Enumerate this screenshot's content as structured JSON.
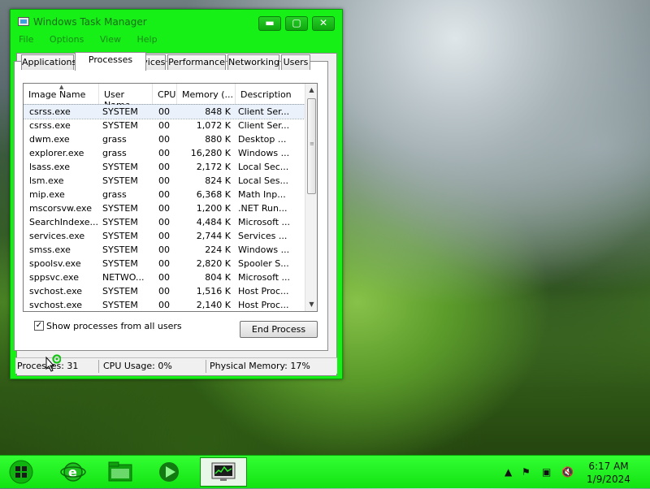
{
  "window": {
    "title": "Windows Task Manager",
    "buttons": {
      "minimize": "▬",
      "maximize": "▢",
      "close": "✕"
    }
  },
  "menu": [
    "File",
    "Options",
    "View",
    "Help"
  ],
  "tabs": [
    "Applications",
    "Processes",
    "Services",
    "Performance",
    "Networking",
    "Users"
  ],
  "active_tab": "Processes",
  "columns": [
    "Image Name",
    "User Name",
    "CPU",
    "Memory (...",
    "Description"
  ],
  "processes": [
    {
      "name": "csrss.exe",
      "user": "SYSTEM",
      "cpu": "00",
      "mem": "848 K",
      "desc": "Client Ser..."
    },
    {
      "name": "csrss.exe",
      "user": "SYSTEM",
      "cpu": "00",
      "mem": "1,072 K",
      "desc": "Client Ser..."
    },
    {
      "name": "dwm.exe",
      "user": "grass",
      "cpu": "00",
      "mem": "880 K",
      "desc": "Desktop ..."
    },
    {
      "name": "explorer.exe",
      "user": "grass",
      "cpu": "00",
      "mem": "16,280 K",
      "desc": "Windows ..."
    },
    {
      "name": "lsass.exe",
      "user": "SYSTEM",
      "cpu": "00",
      "mem": "2,172 K",
      "desc": "Local Sec..."
    },
    {
      "name": "lsm.exe",
      "user": "SYSTEM",
      "cpu": "00",
      "mem": "824 K",
      "desc": "Local Ses..."
    },
    {
      "name": "mip.exe",
      "user": "grass",
      "cpu": "00",
      "mem": "6,368 K",
      "desc": "Math Inp..."
    },
    {
      "name": "mscorsvw.exe",
      "user": "SYSTEM",
      "cpu": "00",
      "mem": "1,200 K",
      "desc": ".NET Run..."
    },
    {
      "name": "SearchIndexe...",
      "user": "SYSTEM",
      "cpu": "00",
      "mem": "4,484 K",
      "desc": "Microsoft ..."
    },
    {
      "name": "services.exe",
      "user": "SYSTEM",
      "cpu": "00",
      "mem": "2,744 K",
      "desc": "Services ..."
    },
    {
      "name": "smss.exe",
      "user": "SYSTEM",
      "cpu": "00",
      "mem": "224 K",
      "desc": "Windows ..."
    },
    {
      "name": "spoolsv.exe",
      "user": "SYSTEM",
      "cpu": "00",
      "mem": "2,820 K",
      "desc": "Spooler S..."
    },
    {
      "name": "sppsvc.exe",
      "user": "NETWO...",
      "cpu": "00",
      "mem": "804 K",
      "desc": "Microsoft ..."
    },
    {
      "name": "svchost.exe",
      "user": "SYSTEM",
      "cpu": "00",
      "mem": "1,516 K",
      "desc": "Host Proc..."
    },
    {
      "name": "svchost.exe",
      "user": "SYSTEM",
      "cpu": "00",
      "mem": "2,140 K",
      "desc": "Host Proc..."
    }
  ],
  "show_all_label": "Show processes from all users",
  "show_all_checked": true,
  "end_process_label": "End Process",
  "status": {
    "processes": "Processes: 31",
    "cpu": "CPU Usage: 0%",
    "memory": "Physical Memory: 17%"
  },
  "clock": {
    "time": "6:17 AM",
    "date": "1/9/2024"
  },
  "colors": {
    "accent": "#16f016",
    "taskbar": "#22f022"
  },
  "icons": [
    "start-orb-icon",
    "internet-explorer-icon",
    "folder-icon",
    "media-player-icon",
    "task-manager-icon",
    "show-hidden-icons-icon",
    "action-center-flag-icon",
    "network-icon",
    "volume-muted-icon"
  ]
}
